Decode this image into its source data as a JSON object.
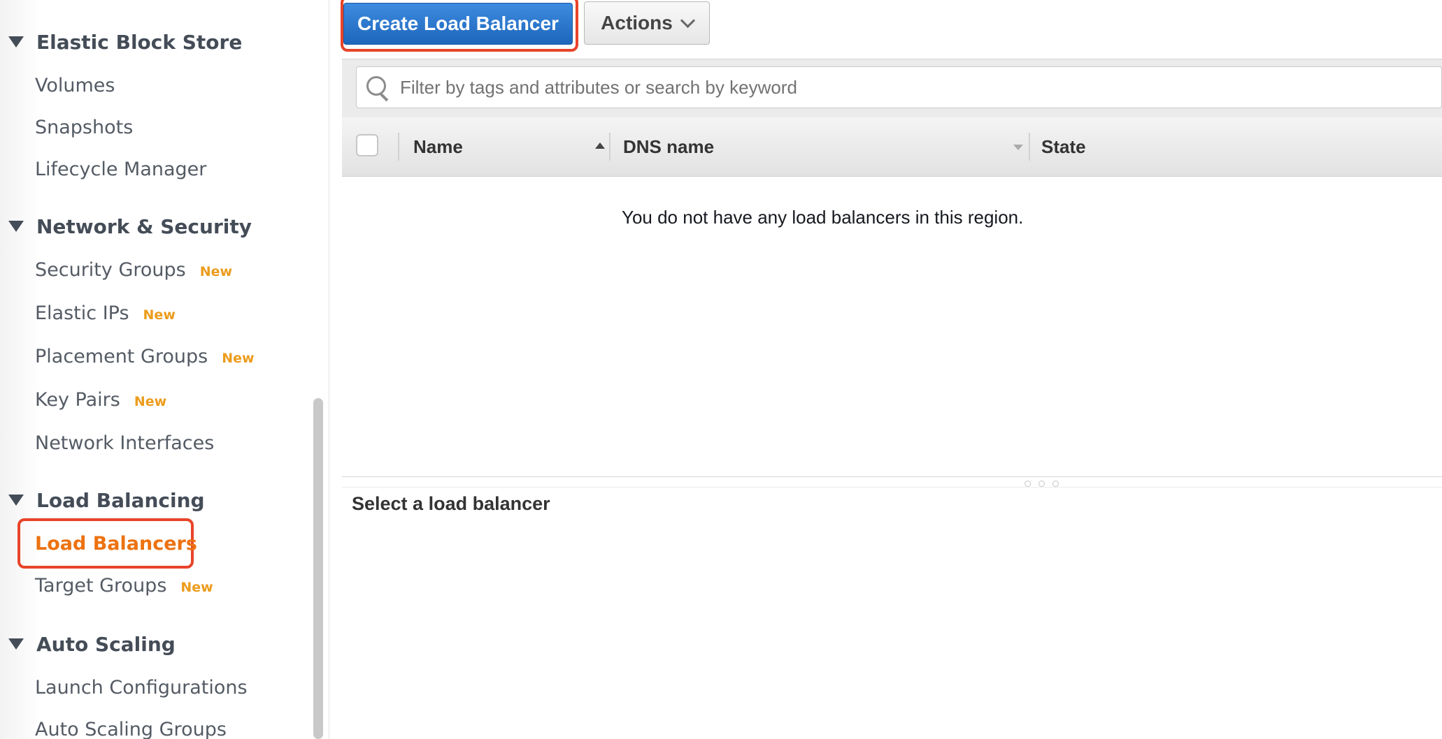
{
  "sidebar": {
    "sections": [
      {
        "title": "Elastic Block Store",
        "items": [
          {
            "label": "Volumes",
            "badge": ""
          },
          {
            "label": "Snapshots",
            "badge": ""
          },
          {
            "label": "Lifecycle Manager",
            "badge": ""
          }
        ]
      },
      {
        "title": "Network & Security",
        "items": [
          {
            "label": "Security Groups",
            "badge": "New"
          },
          {
            "label": "Elastic IPs",
            "badge": "New"
          },
          {
            "label": "Placement Groups",
            "badge": "New"
          },
          {
            "label": "Key Pairs",
            "badge": "New"
          },
          {
            "label": "Network Interfaces",
            "badge": ""
          }
        ]
      },
      {
        "title": "Load Balancing",
        "items": [
          {
            "label": "Load Balancers",
            "badge": "",
            "active": true
          },
          {
            "label": "Target Groups",
            "badge": "New"
          }
        ]
      },
      {
        "title": "Auto Scaling",
        "items": [
          {
            "label": "Launch Configurations",
            "badge": ""
          },
          {
            "label": "Auto Scaling Groups",
            "badge": ""
          }
        ]
      }
    ]
  },
  "toolbar": {
    "create_label": "Create Load Balancer",
    "actions_label": "Actions"
  },
  "search": {
    "placeholder": "Filter by tags and attributes or search by keyword",
    "value": ""
  },
  "table": {
    "columns": [
      "Name",
      "DNS name",
      "State"
    ],
    "empty_message": "You do not have any load balancers in this region."
  },
  "details": {
    "title": "Select a load balancer"
  },
  "colors": {
    "accent": "#ec7211",
    "primary_button": "#1d66bb",
    "highlight_outline": "#e8442a",
    "badge": "#ec9c1d"
  }
}
